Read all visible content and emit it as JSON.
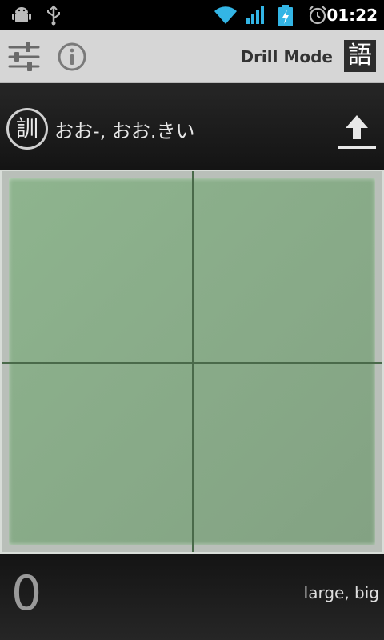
{
  "status_bar": {
    "time": "01:22",
    "icons": [
      "android-debug-icon",
      "usb-icon",
      "wifi-icon",
      "signal-icon",
      "battery-charging-icon",
      "alarm-icon"
    ]
  },
  "action_bar": {
    "settings_icon": "sliders-icon",
    "info_icon": "info-icon",
    "mode_label": "Drill Mode",
    "kanji_badge": "語"
  },
  "reading": {
    "type_icon_label": "訓",
    "text": "おお-, おお.きい",
    "upload_icon": "upload-icon"
  },
  "canvas": {
    "background_color": "#88aa88",
    "guide_color": "#4a6a4a"
  },
  "footer": {
    "score": "0",
    "meaning": "large, big"
  }
}
